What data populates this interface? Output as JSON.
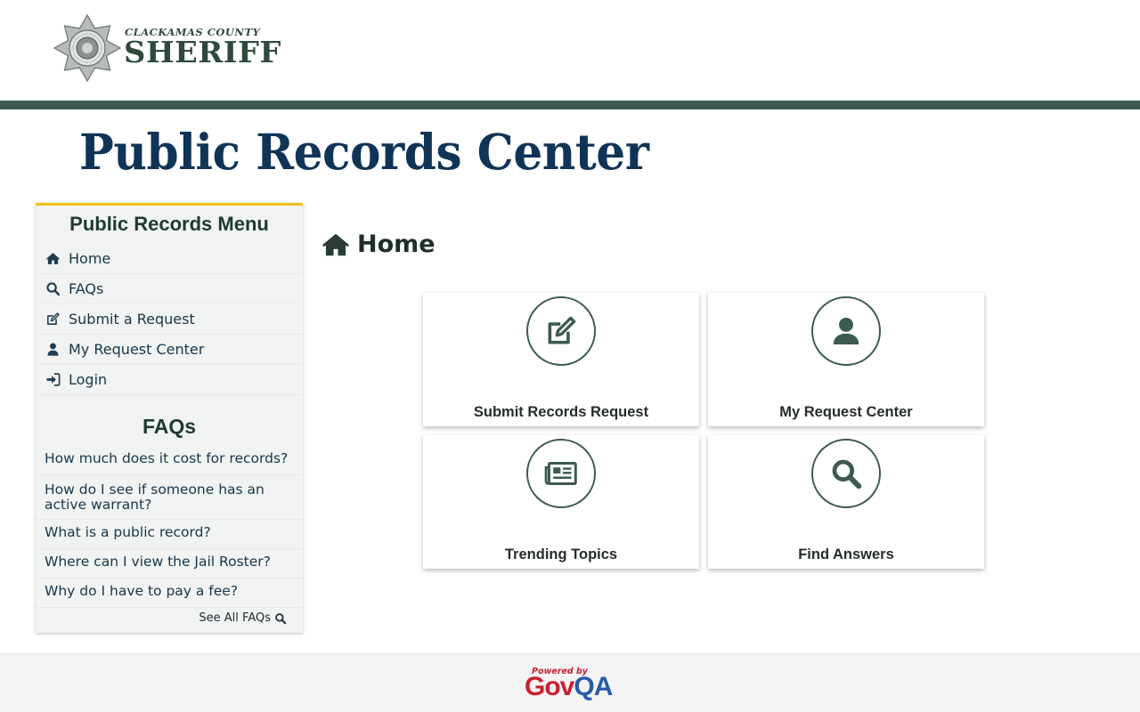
{
  "header": {
    "logo_county": "CLACKAMAS COUNTY",
    "logo_title": "SHERIFF",
    "star_ring_text": "CLACKAMAS COUNTY SHERIFF",
    "brand_color": "#3d5a4f"
  },
  "page": {
    "title": "Public Records Center"
  },
  "sidebar": {
    "menu_heading": "Public Records Menu",
    "menu_items": [
      {
        "label": "Home",
        "icon": "home-icon"
      },
      {
        "label": "FAQs",
        "icon": "search-icon"
      },
      {
        "label": "Submit a Request",
        "icon": "edit-icon"
      },
      {
        "label": "My Request Center",
        "icon": "user-icon"
      },
      {
        "label": "Login",
        "icon": "sign-in-icon"
      }
    ],
    "faq_heading": "FAQs",
    "faq_items": [
      "How much does it cost for records?",
      "How do I see if someone has an active warrant?",
      "What is a public record?",
      "Where can I view the Jail Roster?",
      "Why do I have to pay a fee?"
    ],
    "see_all": "See All FAQs",
    "accent_color": "#f1c21b"
  },
  "main": {
    "heading": "Home",
    "tiles": [
      {
        "label": "Submit Records Request",
        "icon": "edit-icon"
      },
      {
        "label": "My Request Center",
        "icon": "user-icon"
      },
      {
        "label": "Trending Topics",
        "icon": "newspaper-icon"
      },
      {
        "label": "Find Answers",
        "icon": "search-icon"
      }
    ]
  },
  "footer": {
    "powered_by": "Powered by",
    "brand_gov": "Gov",
    "brand_qa": "QA"
  }
}
